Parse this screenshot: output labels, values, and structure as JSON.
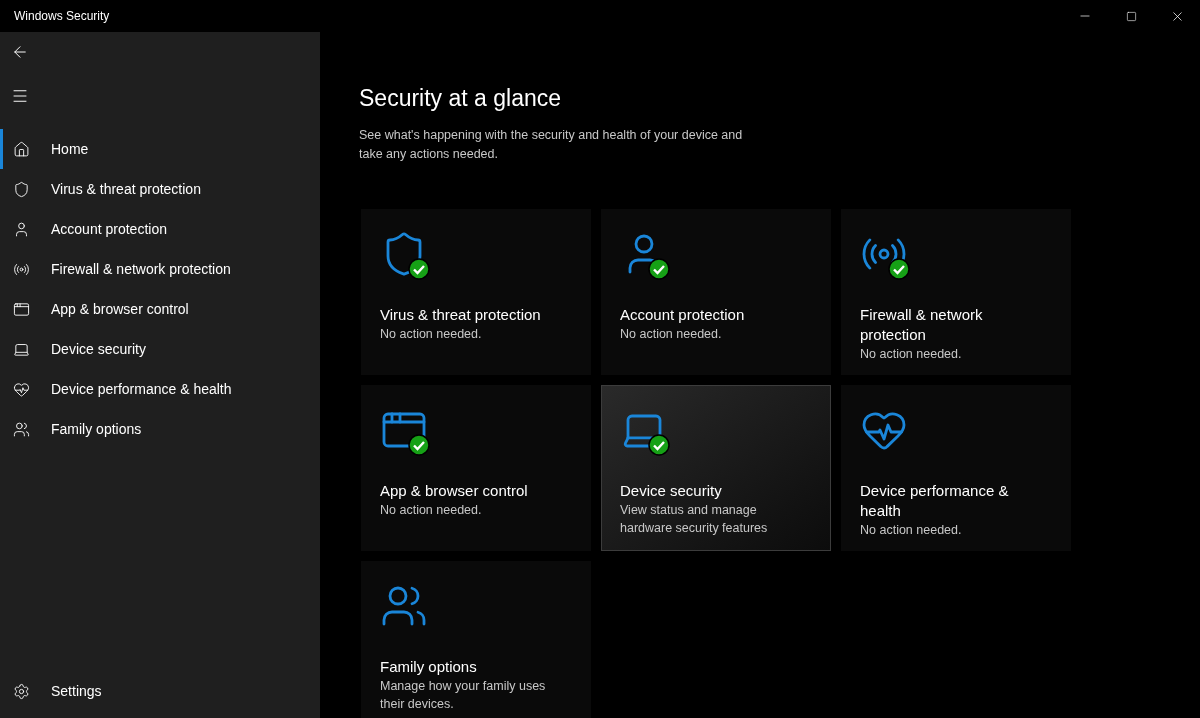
{
  "window": {
    "title": "Windows Security"
  },
  "sidebar": {
    "items": [
      {
        "label": "Home",
        "kind": "home",
        "selected": true
      },
      {
        "label": "Virus & threat protection",
        "kind": "shield",
        "selected": false
      },
      {
        "label": "Account protection",
        "kind": "person",
        "selected": false
      },
      {
        "label": "Firewall & network protection",
        "kind": "antenna",
        "selected": false
      },
      {
        "label": "App & browser control",
        "kind": "window",
        "selected": false
      },
      {
        "label": "Device security",
        "kind": "laptop",
        "selected": false
      },
      {
        "label": "Device performance & health",
        "kind": "heart",
        "selected": false
      },
      {
        "label": "Family options",
        "kind": "family",
        "selected": false
      }
    ],
    "settings": {
      "label": "Settings"
    }
  },
  "page": {
    "title": "Security at a glance",
    "description": "See what's happening with the security and health of your device and take any actions needed."
  },
  "tiles": [
    {
      "title": "Virus & threat protection",
      "status": "No action needed.",
      "kind": "shield",
      "ok": true,
      "highlighted": false
    },
    {
      "title": "Account protection",
      "status": "No action needed.",
      "kind": "person",
      "ok": true,
      "highlighted": false
    },
    {
      "title": "Firewall & network protection",
      "status": "No action needed.",
      "kind": "antenna",
      "ok": true,
      "highlighted": false
    },
    {
      "title": "App & browser control",
      "status": "No action needed.",
      "kind": "window",
      "ok": true,
      "highlighted": false
    },
    {
      "title": "Device security",
      "status": "View status and manage hardware security features",
      "kind": "laptop",
      "ok": true,
      "highlighted": true
    },
    {
      "title": "Device performance & health",
      "status": "No action needed.",
      "kind": "heart",
      "ok": false,
      "highlighted": false
    },
    {
      "title": "Family options",
      "status": "Manage how your family uses their devices.",
      "kind": "family",
      "ok": false,
      "highlighted": false
    }
  ]
}
